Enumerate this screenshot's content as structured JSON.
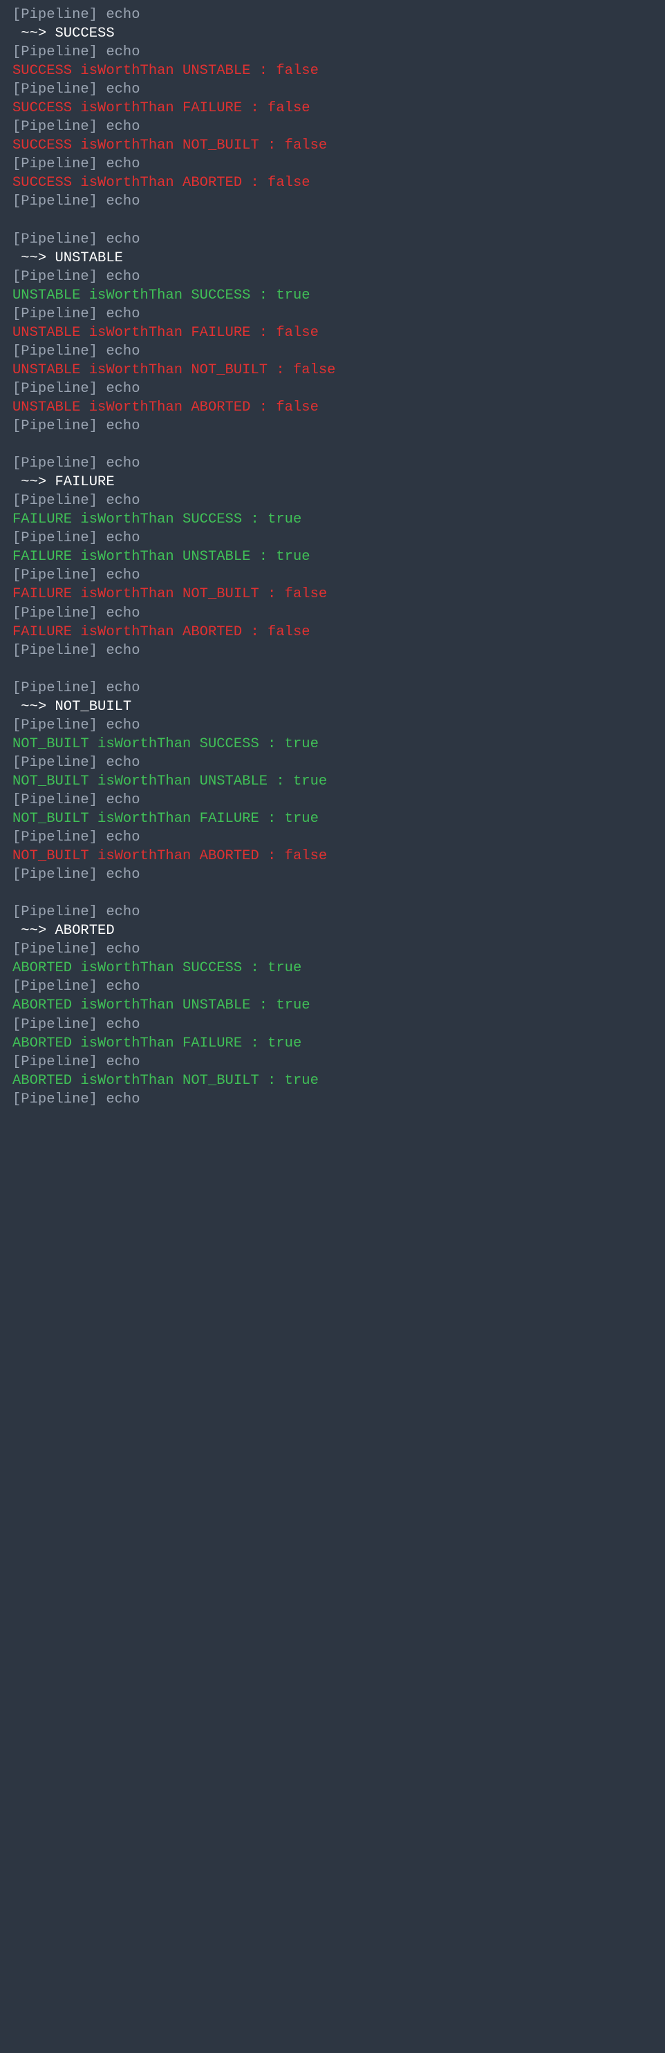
{
  "colors": {
    "dim": "#9aa4b2",
    "white": "#ffffff",
    "red": "#e03131",
    "green": "#40c057",
    "bg": "#2d3642"
  },
  "pipeline_echo": "[Pipeline] echo",
  "section_prefix": " ~~> ",
  "sections": [
    {
      "title": "SUCCESS",
      "results": [
        {
          "text": "SUCCESS isWorthThan UNSTABLE : false",
          "color": "red"
        },
        {
          "text": "SUCCESS isWorthThan FAILURE : false",
          "color": "red"
        },
        {
          "text": "SUCCESS isWorthThan NOT_BUILT : false",
          "color": "red"
        },
        {
          "text": "SUCCESS isWorthThan ABORTED : false",
          "color": "red"
        }
      ]
    },
    {
      "title": "UNSTABLE",
      "results": [
        {
          "text": "UNSTABLE isWorthThan SUCCESS : true",
          "color": "green"
        },
        {
          "text": "UNSTABLE isWorthThan FAILURE : false",
          "color": "red"
        },
        {
          "text": "UNSTABLE isWorthThan NOT_BUILT : false",
          "color": "red"
        },
        {
          "text": "UNSTABLE isWorthThan ABORTED : false",
          "color": "red"
        }
      ]
    },
    {
      "title": "FAILURE",
      "results": [
        {
          "text": "FAILURE isWorthThan SUCCESS : true",
          "color": "green"
        },
        {
          "text": "FAILURE isWorthThan UNSTABLE : true",
          "color": "green"
        },
        {
          "text": "FAILURE isWorthThan NOT_BUILT : false",
          "color": "red"
        },
        {
          "text": "FAILURE isWorthThan ABORTED : false",
          "color": "red"
        }
      ]
    },
    {
      "title": "NOT_BUILT",
      "results": [
        {
          "text": "NOT_BUILT isWorthThan SUCCESS : true",
          "color": "green"
        },
        {
          "text": "NOT_BUILT isWorthThan UNSTABLE : true",
          "color": "green"
        },
        {
          "text": "NOT_BUILT isWorthThan FAILURE : true",
          "color": "green"
        },
        {
          "text": "NOT_BUILT isWorthThan ABORTED : false",
          "color": "red"
        }
      ]
    },
    {
      "title": "ABORTED",
      "results": [
        {
          "text": "ABORTED isWorthThan SUCCESS : true",
          "color": "green"
        },
        {
          "text": "ABORTED isWorthThan UNSTABLE : true",
          "color": "green"
        },
        {
          "text": "ABORTED isWorthThan FAILURE : true",
          "color": "green"
        },
        {
          "text": "ABORTED isWorthThan NOT_BUILT : true",
          "color": "green"
        }
      ]
    }
  ]
}
